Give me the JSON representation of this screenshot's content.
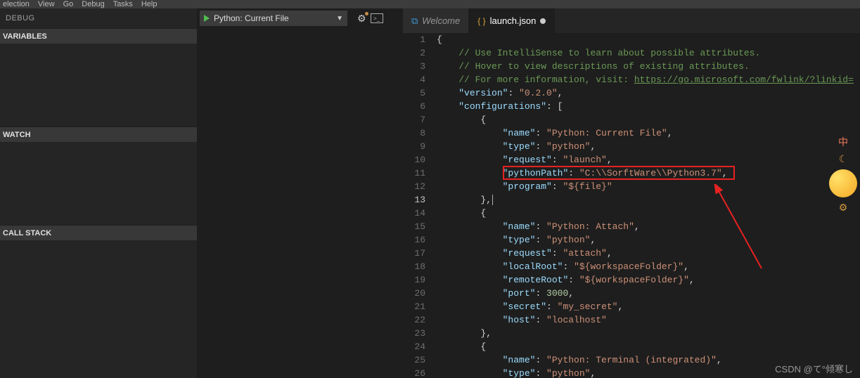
{
  "menubar": {
    "items": [
      "election",
      "View",
      "Go",
      "Debug",
      "Tasks",
      "Help"
    ]
  },
  "debug": {
    "title": "DEBUG",
    "config_selected": "Python: Current File",
    "sections": {
      "variables": "VARIABLES",
      "watch": "WATCH",
      "callstack": "CALL STACK"
    }
  },
  "tabs": {
    "welcome": {
      "label": "Welcome"
    },
    "launch": {
      "label": "launch.json",
      "dirty": true
    }
  },
  "editor": {
    "active_line": 13,
    "lines": [
      {
        "n": 1,
        "indent": 0,
        "tokens": [
          {
            "t": "p",
            "v": "{"
          }
        ]
      },
      {
        "n": 2,
        "indent": 1,
        "tokens": [
          {
            "t": "c",
            "v": "// Use IntelliSense to learn about possible attributes."
          }
        ]
      },
      {
        "n": 3,
        "indent": 1,
        "tokens": [
          {
            "t": "c",
            "v": "// Hover to view descriptions of existing attributes."
          }
        ]
      },
      {
        "n": 4,
        "indent": 1,
        "tokens": [
          {
            "t": "c",
            "v": "// For more information, visit: "
          },
          {
            "t": "lnk",
            "v": "https://go.microsoft.com/fwlink/?linkid="
          }
        ]
      },
      {
        "n": 5,
        "indent": 1,
        "tokens": [
          {
            "t": "k",
            "v": "\"version\""
          },
          {
            "t": "p",
            "v": ": "
          },
          {
            "t": "s",
            "v": "\"0.2.0\""
          },
          {
            "t": "p",
            "v": ","
          }
        ]
      },
      {
        "n": 6,
        "indent": 1,
        "tokens": [
          {
            "t": "k",
            "v": "\"configurations\""
          },
          {
            "t": "p",
            "v": ": ["
          }
        ]
      },
      {
        "n": 7,
        "indent": 2,
        "tokens": [
          {
            "t": "p",
            "v": "{"
          }
        ]
      },
      {
        "n": 8,
        "indent": 3,
        "tokens": [
          {
            "t": "k",
            "v": "\"name\""
          },
          {
            "t": "p",
            "v": ": "
          },
          {
            "t": "s",
            "v": "\"Python: Current File\""
          },
          {
            "t": "p",
            "v": ","
          }
        ]
      },
      {
        "n": 9,
        "indent": 3,
        "tokens": [
          {
            "t": "k",
            "v": "\"type\""
          },
          {
            "t": "p",
            "v": ": "
          },
          {
            "t": "s",
            "v": "\"python\""
          },
          {
            "t": "p",
            "v": ","
          }
        ]
      },
      {
        "n": 10,
        "indent": 3,
        "tokens": [
          {
            "t": "k",
            "v": "\"request\""
          },
          {
            "t": "p",
            "v": ": "
          },
          {
            "t": "s",
            "v": "\"launch\""
          },
          {
            "t": "p",
            "v": ","
          }
        ]
      },
      {
        "n": 11,
        "indent": 3,
        "tokens": [
          {
            "t": "k",
            "v": "\"pythonPath\""
          },
          {
            "t": "p",
            "v": ": "
          },
          {
            "t": "s",
            "v": "\"C:\\\\SorftWare\\\\Python3.7\""
          },
          {
            "t": "p",
            "v": ","
          }
        ]
      },
      {
        "n": 12,
        "indent": 3,
        "tokens": [
          {
            "t": "k",
            "v": "\"program\""
          },
          {
            "t": "p",
            "v": ": "
          },
          {
            "t": "s",
            "v": "\"${file}\""
          }
        ]
      },
      {
        "n": 13,
        "indent": 2,
        "tokens": [
          {
            "t": "p",
            "v": "},"
          }
        ],
        "cursor": true
      },
      {
        "n": 14,
        "indent": 2,
        "tokens": [
          {
            "t": "p",
            "v": "{"
          }
        ]
      },
      {
        "n": 15,
        "indent": 3,
        "tokens": [
          {
            "t": "k",
            "v": "\"name\""
          },
          {
            "t": "p",
            "v": ": "
          },
          {
            "t": "s",
            "v": "\"Python: Attach\""
          },
          {
            "t": "p",
            "v": ","
          }
        ]
      },
      {
        "n": 16,
        "indent": 3,
        "tokens": [
          {
            "t": "k",
            "v": "\"type\""
          },
          {
            "t": "p",
            "v": ": "
          },
          {
            "t": "s",
            "v": "\"python\""
          },
          {
            "t": "p",
            "v": ","
          }
        ]
      },
      {
        "n": 17,
        "indent": 3,
        "tokens": [
          {
            "t": "k",
            "v": "\"request\""
          },
          {
            "t": "p",
            "v": ": "
          },
          {
            "t": "s",
            "v": "\"attach\""
          },
          {
            "t": "p",
            "v": ","
          }
        ]
      },
      {
        "n": 18,
        "indent": 3,
        "tokens": [
          {
            "t": "k",
            "v": "\"localRoot\""
          },
          {
            "t": "p",
            "v": ": "
          },
          {
            "t": "s",
            "v": "\"${workspaceFolder}\""
          },
          {
            "t": "p",
            "v": ","
          }
        ]
      },
      {
        "n": 19,
        "indent": 3,
        "tokens": [
          {
            "t": "k",
            "v": "\"remoteRoot\""
          },
          {
            "t": "p",
            "v": ": "
          },
          {
            "t": "s",
            "v": "\"${workspaceFolder}\""
          },
          {
            "t": "p",
            "v": ","
          }
        ]
      },
      {
        "n": 20,
        "indent": 3,
        "tokens": [
          {
            "t": "k",
            "v": "\"port\""
          },
          {
            "t": "p",
            "v": ": "
          },
          {
            "t": "n",
            "v": "3000"
          },
          {
            "t": "p",
            "v": ","
          }
        ]
      },
      {
        "n": 21,
        "indent": 3,
        "tokens": [
          {
            "t": "k",
            "v": "\"secret\""
          },
          {
            "t": "p",
            "v": ": "
          },
          {
            "t": "s",
            "v": "\"my_secret\""
          },
          {
            "t": "p",
            "v": ","
          }
        ]
      },
      {
        "n": 22,
        "indent": 3,
        "tokens": [
          {
            "t": "k",
            "v": "\"host\""
          },
          {
            "t": "p",
            "v": ": "
          },
          {
            "t": "s",
            "v": "\"localhost\""
          }
        ]
      },
      {
        "n": 23,
        "indent": 2,
        "tokens": [
          {
            "t": "p",
            "v": "},"
          }
        ]
      },
      {
        "n": 24,
        "indent": 2,
        "tokens": [
          {
            "t": "p",
            "v": "{"
          }
        ]
      },
      {
        "n": 25,
        "indent": 3,
        "tokens": [
          {
            "t": "k",
            "v": "\"name\""
          },
          {
            "t": "p",
            "v": ": "
          },
          {
            "t": "s",
            "v": "\"Python: Terminal (integrated)\""
          },
          {
            "t": "p",
            "v": ","
          }
        ]
      },
      {
        "n": 26,
        "indent": 3,
        "tokens": [
          {
            "t": "k",
            "v": "\"type\""
          },
          {
            "t": "p",
            "v": ": "
          },
          {
            "t": "s",
            "v": "\"python\""
          },
          {
            "t": "p",
            "v": ","
          }
        ]
      }
    ]
  },
  "watermark": "CSDN @て°倾寒し",
  "side_char": "中"
}
